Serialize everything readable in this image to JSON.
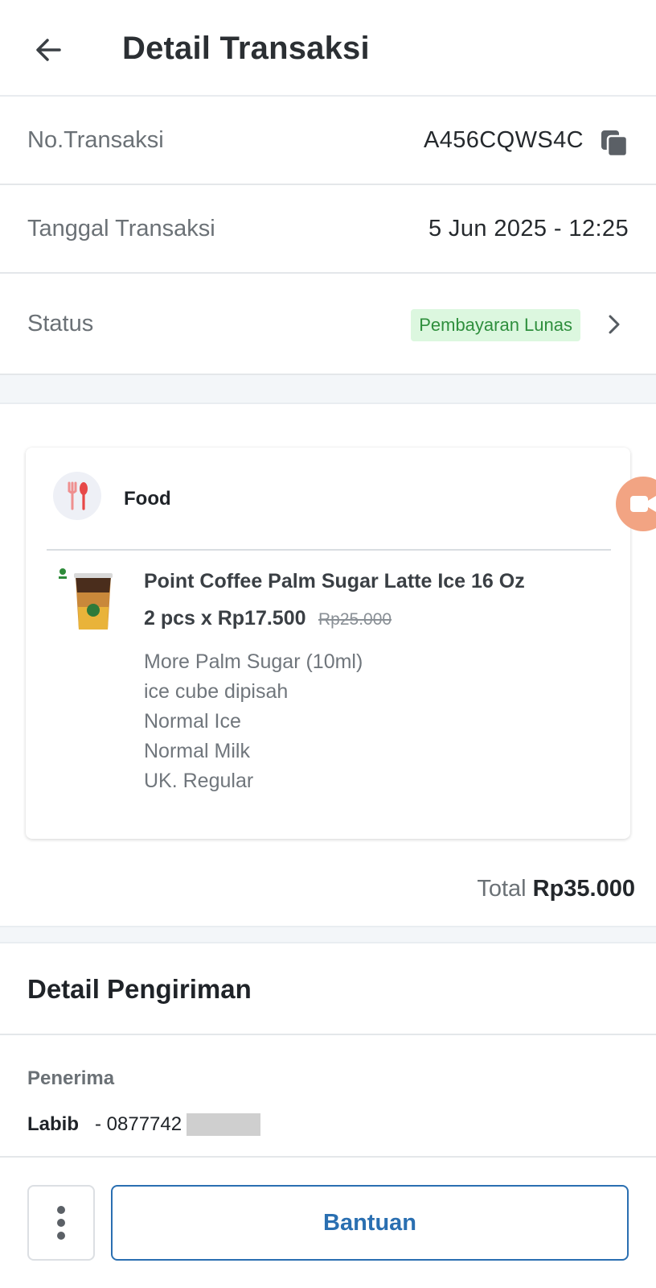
{
  "header": {
    "title": "Detail Transaksi",
    "back_icon": "arrow-left-icon"
  },
  "transaction": {
    "number_label": "No.Transaksi",
    "number_value": "A456CQWS4C",
    "copy_icon": "copy-icon",
    "date_label": "Tanggal Transaksi",
    "date_value": "5 Jun 2025 - 12:25",
    "status_label": "Status",
    "status_value": "Pembayaran Lunas",
    "status_color": "#2f8f3d",
    "status_bg": "#dcf7df"
  },
  "order": {
    "category_label": "Food",
    "category_icon": "food-icon",
    "item": {
      "name": "Point Coffee Palm Sugar Latte Ice 16 Oz",
      "qty_price": "2 pcs x Rp17.500",
      "original_price": "Rp25.000",
      "notes": [
        "More Palm Sugar (10ml)",
        "ice cube dipisah",
        "Normal Ice",
        "Normal Milk",
        "UK. Regular"
      ]
    },
    "total_label": "Total",
    "total_value": "Rp35.000"
  },
  "shipping": {
    "title": "Detail Pengiriman",
    "recipient_label": "Penerima",
    "recipient_name": "Labib",
    "recipient_phone": "- 0877742"
  },
  "actions": {
    "more_icon": "more-vertical-icon",
    "help_label": "Bantuan",
    "accent_color": "#2a6fb1"
  }
}
